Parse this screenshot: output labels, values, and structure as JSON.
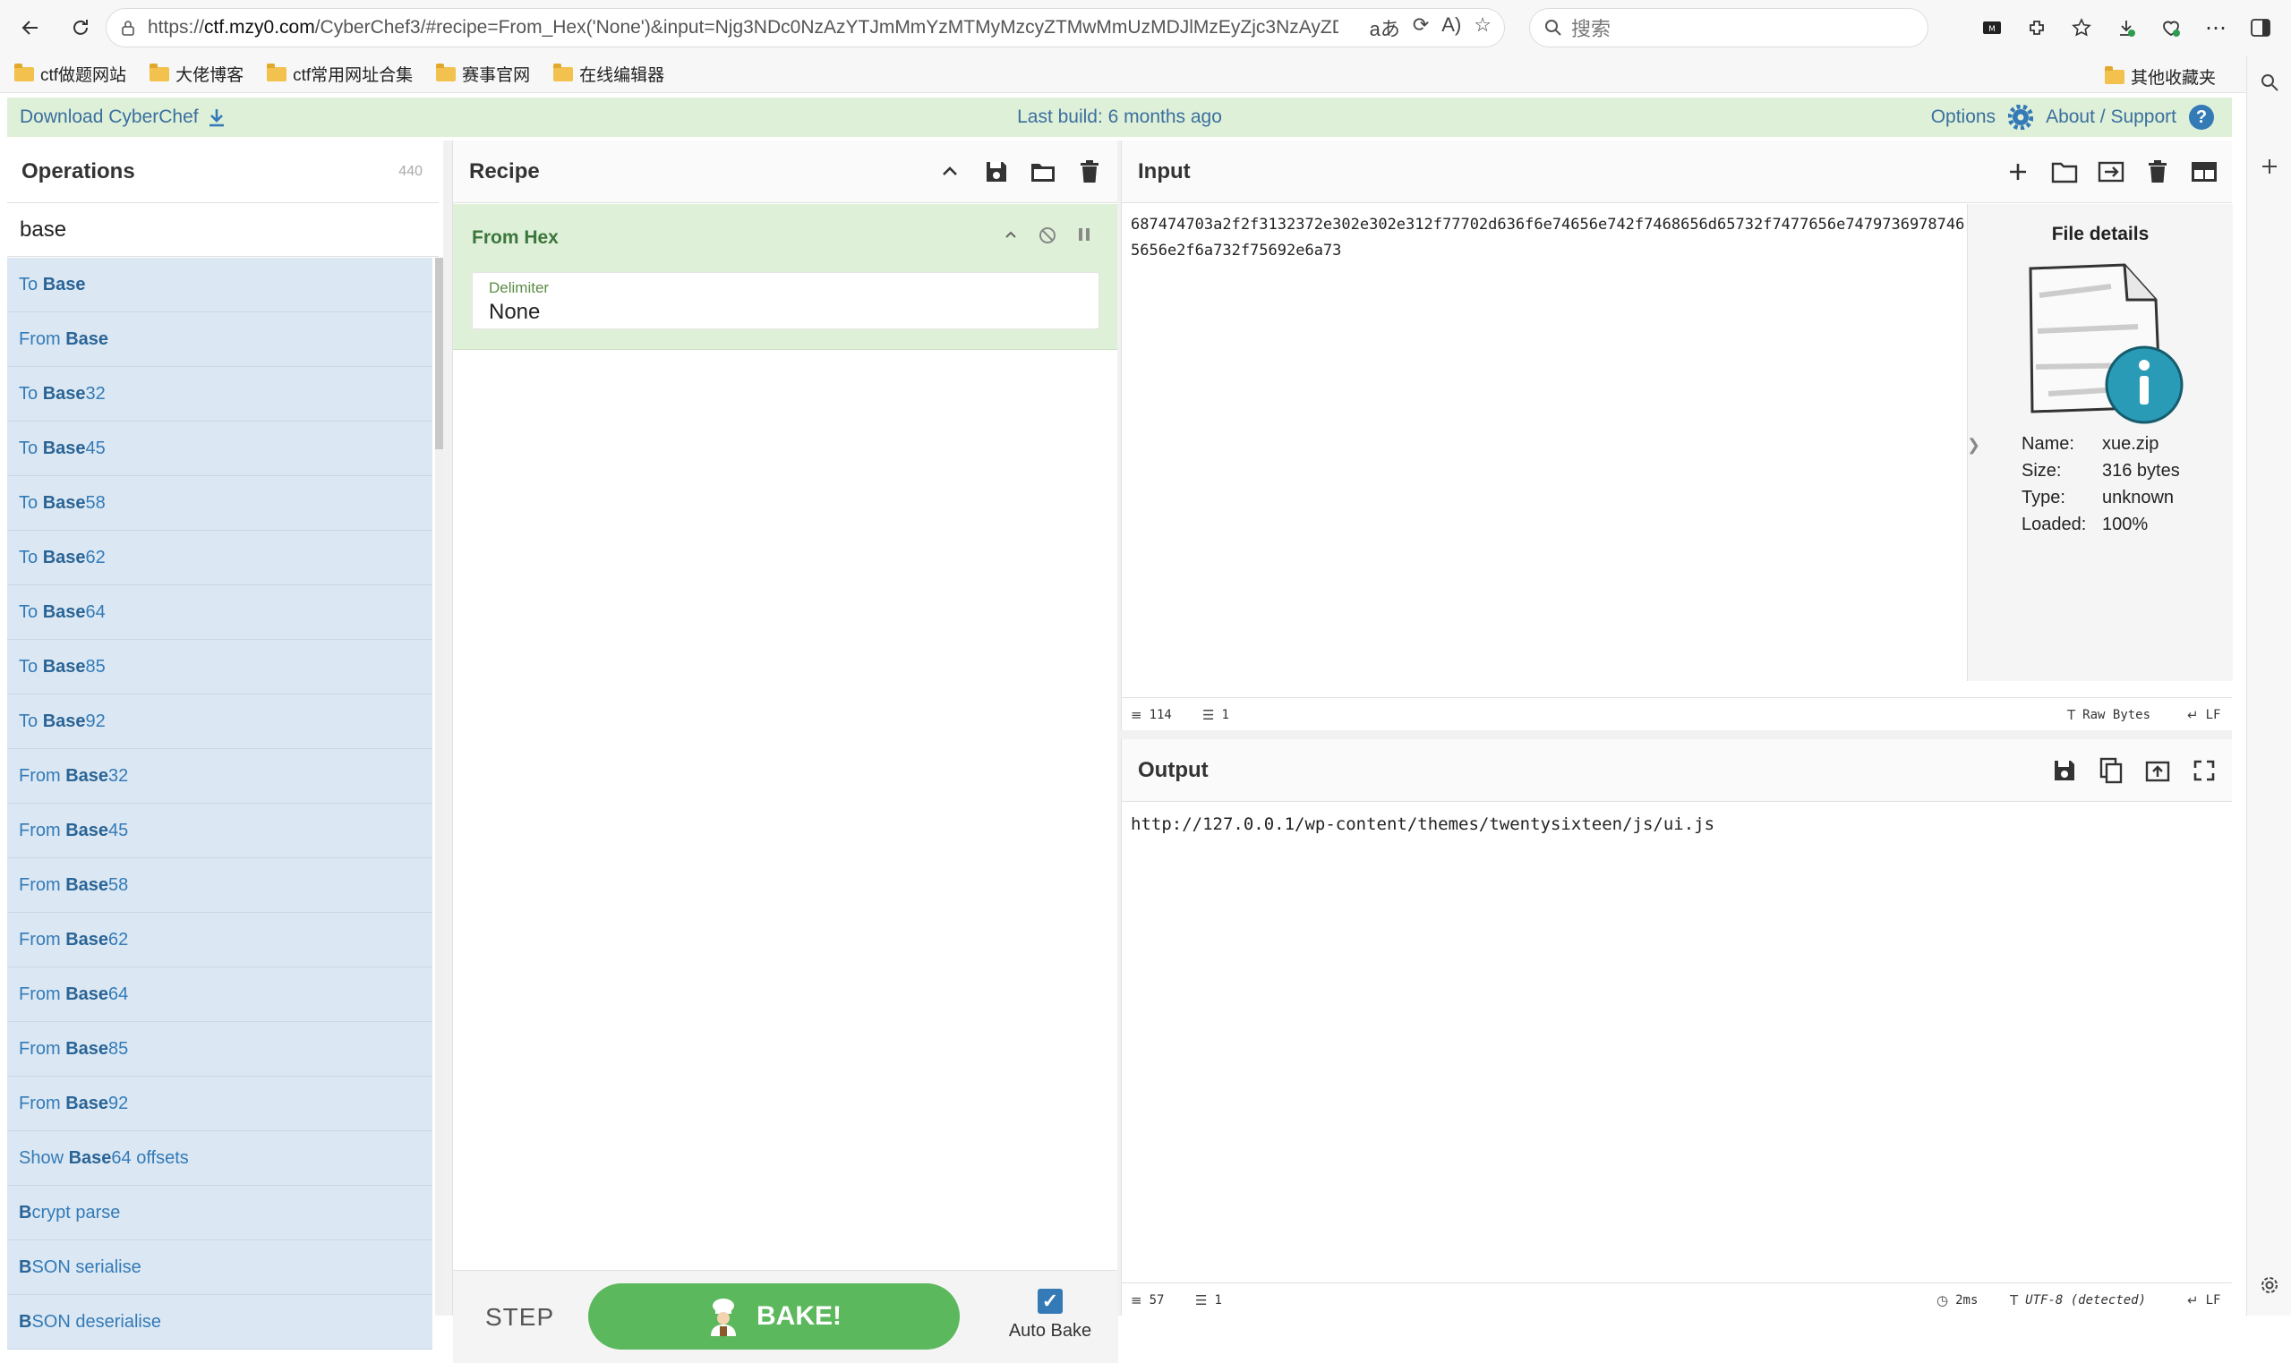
{
  "browser": {
    "url_prefix": "https://",
    "url_host": "ctf.mzy0.com",
    "url_rest": "/CyberChef3/#recipe=From_Hex('None')&input=Njg3NDc0NzAzYTJmMmYzMTMyMzcyZTMwMmUzMDJlMzEyZjc3NzAyZDYzNzAyZjc3...",
    "search_placeholder": "搜索",
    "bookmarks": [
      "ctf做题网站",
      "大佬博客",
      "ctf常用网址合集",
      "赛事官网",
      "在线编辑器"
    ],
    "other_bookmarks": "其他收藏夹"
  },
  "banner": {
    "download": "Download CyberChef",
    "build": "Last build: 6 months ago",
    "options": "Options",
    "about": "About / Support"
  },
  "operations": {
    "title": "Operations",
    "count": "440",
    "search_value": "base",
    "items": [
      {
        "pre": "To ",
        "hl": "Base",
        "post": ""
      },
      {
        "pre": "From ",
        "hl": "Base",
        "post": ""
      },
      {
        "pre": "To ",
        "hl": "Base",
        "post": "32"
      },
      {
        "pre": "To ",
        "hl": "Base",
        "post": "45"
      },
      {
        "pre": "To ",
        "hl": "Base",
        "post": "58"
      },
      {
        "pre": "To ",
        "hl": "Base",
        "post": "62"
      },
      {
        "pre": "To ",
        "hl": "Base",
        "post": "64"
      },
      {
        "pre": "To ",
        "hl": "Base",
        "post": "85"
      },
      {
        "pre": "To ",
        "hl": "Base",
        "post": "92"
      },
      {
        "pre": "From ",
        "hl": "Base",
        "post": "32"
      },
      {
        "pre": "From ",
        "hl": "Base",
        "post": "45"
      },
      {
        "pre": "From ",
        "hl": "Base",
        "post": "58"
      },
      {
        "pre": "From ",
        "hl": "Base",
        "post": "62"
      },
      {
        "pre": "From ",
        "hl": "Base",
        "post": "64"
      },
      {
        "pre": "From ",
        "hl": "Base",
        "post": "85"
      },
      {
        "pre": "From ",
        "hl": "Base",
        "post": "92"
      },
      {
        "pre": "Show ",
        "hl": "Base",
        "post": "64 offsets"
      },
      {
        "pre": "",
        "hl": "B",
        "post": "crypt parse"
      },
      {
        "pre": "",
        "hl": "B",
        "post": "SON serialise"
      },
      {
        "pre": "",
        "hl": "B",
        "post": "SON deserialise"
      }
    ]
  },
  "recipe": {
    "title": "Recipe",
    "operation_name": "From Hex",
    "delimiter_label": "Delimiter",
    "delimiter_value": "None",
    "step": "STEP",
    "bake": "BAKE!",
    "auto_bake": "Auto Bake"
  },
  "input": {
    "title": "Input",
    "text": "687474703a2f2f3132372e302e302e312f77702d636f6e74656e742f7468656d65732f7477656e74797369787465656e2f6a732f75692e6a73",
    "length": "114",
    "lines": "1",
    "format": "Raw Bytes",
    "eol": "LF"
  },
  "file_details": {
    "title": "File details",
    "name_label": "Name:",
    "name": "xue.zip",
    "size_label": "Size:",
    "size": "316 bytes",
    "type_label": "Type:",
    "type": "unknown",
    "loaded_label": "Loaded:",
    "loaded": "100%"
  },
  "output": {
    "title": "Output",
    "text": "http://127.0.0.1/wp-content/themes/twentysixteen/js/ui.js",
    "length": "57",
    "lines": "1",
    "time": "2ms",
    "encoding": "UTF-8 (detected)",
    "eol": "LF"
  },
  "colors": {
    "banner_bg": "#dff0d8",
    "op_item_bg": "#dbe8f3",
    "bake_green": "#5cb85c",
    "link_blue": "#337ab7"
  }
}
